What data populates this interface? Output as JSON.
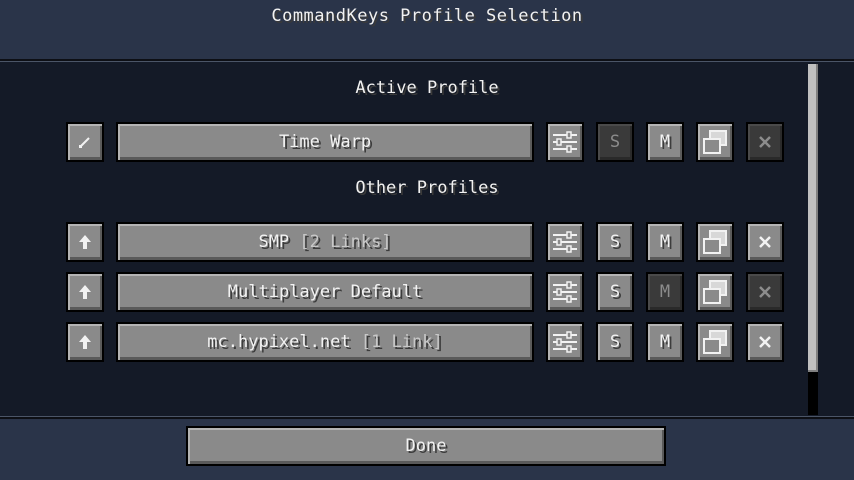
{
  "window": {
    "title": "CommandKeys Profile Selection"
  },
  "sections": {
    "active_heading": "Active Profile",
    "other_heading": "Other Profiles"
  },
  "active_profile": {
    "name": "Time Warp",
    "left_icon": "link-icon",
    "single_label": "S",
    "multi_label": "M",
    "single_enabled": false,
    "multi_enabled": true,
    "copy_enabled": true,
    "delete_enabled": false
  },
  "other_profiles": [
    {
      "name": "SMP",
      "links": "[2 Links]",
      "left_icon": "up-arrow-icon",
      "single_label": "S",
      "multi_label": "M",
      "single_enabled": true,
      "multi_enabled": true,
      "delete_enabled": true
    },
    {
      "name": "Multiplayer Default",
      "links": "",
      "left_icon": "up-arrow-icon",
      "single_label": "S",
      "multi_label": "M",
      "single_enabled": true,
      "multi_enabled": false,
      "delete_enabled": false
    },
    {
      "name": "mc.hypixel.net",
      "links": "[1 Link]",
      "left_icon": "up-arrow-icon",
      "single_label": "S",
      "multi_label": "M",
      "single_enabled": true,
      "multi_enabled": true,
      "delete_enabled": true
    }
  ],
  "footer": {
    "done_label": "Done"
  },
  "icons": {
    "edit": "sliders-icon",
    "copy": "copy-icon",
    "delete": "close-icon"
  }
}
